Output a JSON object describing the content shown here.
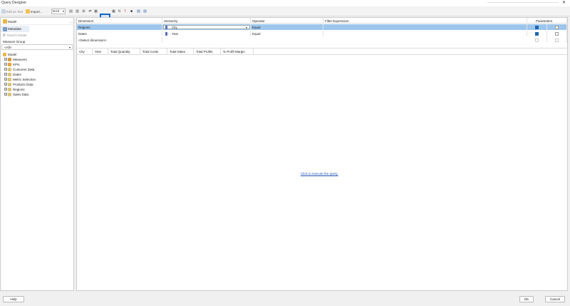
{
  "window": {
    "title": "Query Designer",
    "help_glyph": "?",
    "close_glyph": "✕"
  },
  "toolbar": {
    "edit_as_text": "Edit as Text",
    "import": "Import...",
    "language": "DAX",
    "dropdown_arrow": "▾",
    "buttons": [
      "▤",
      "▥",
      "⊞",
      "⇄",
      "✂",
      "▦",
      "⇅",
      "!",
      "■",
      "▨",
      "▧"
    ]
  },
  "sidebar": {
    "model_label": "Model",
    "metadata_tab": "Metadata",
    "search_placeholder": "Search Model",
    "measure_group_label": "Measure Group",
    "measure_group_value": "<All>",
    "tree": [
      {
        "label": "Model",
        "root": true
      },
      {
        "label": "Measures",
        "expand": "+"
      },
      {
        "label": "KPIs",
        "expand": "+"
      },
      {
        "label": "Customer Data",
        "expand": "+"
      },
      {
        "label": "Dates",
        "expand": "+"
      },
      {
        "label": "Metric Selection",
        "expand": "+"
      },
      {
        "label": "Products Data",
        "expand": "+"
      },
      {
        "label": "Regions",
        "expand": "+"
      },
      {
        "label": "Sales Data",
        "expand": "+"
      }
    ]
  },
  "filter_grid": {
    "headers": {
      "dimension": "Dimension",
      "hierarchy": "Hierarchy",
      "operator": "Operator",
      "filter_expression": "Filter Expression",
      "parameters": "Parameters"
    },
    "rows": [
      {
        "dimension": "Regions",
        "hierarchy": "City",
        "operator": "Equal",
        "filter_expression": "",
        "checked": true,
        "parameter": false,
        "selected": true
      },
      {
        "dimension": "Dates",
        "hierarchy": "Year",
        "operator": "Equal",
        "filter_expression": "",
        "checked": true,
        "parameter": false,
        "selected": false
      }
    ],
    "select_dimension": "<Select dimension>"
  },
  "results": {
    "columns": [
      "City",
      "Year",
      "Total Quantity",
      "Total Costs",
      "Total Sales",
      "Total Profits",
      "% Profit Margin"
    ],
    "execute_link": "Click to execute the query."
  },
  "footer": {
    "help": "Help",
    "ok": "OK",
    "cancel": "Cancel"
  },
  "colors": {
    "selected_row": "#9dc6ec",
    "highlight_border": "#1565c0",
    "link": "#1a4fb3",
    "checkbox_on": "#1e63b0"
  }
}
